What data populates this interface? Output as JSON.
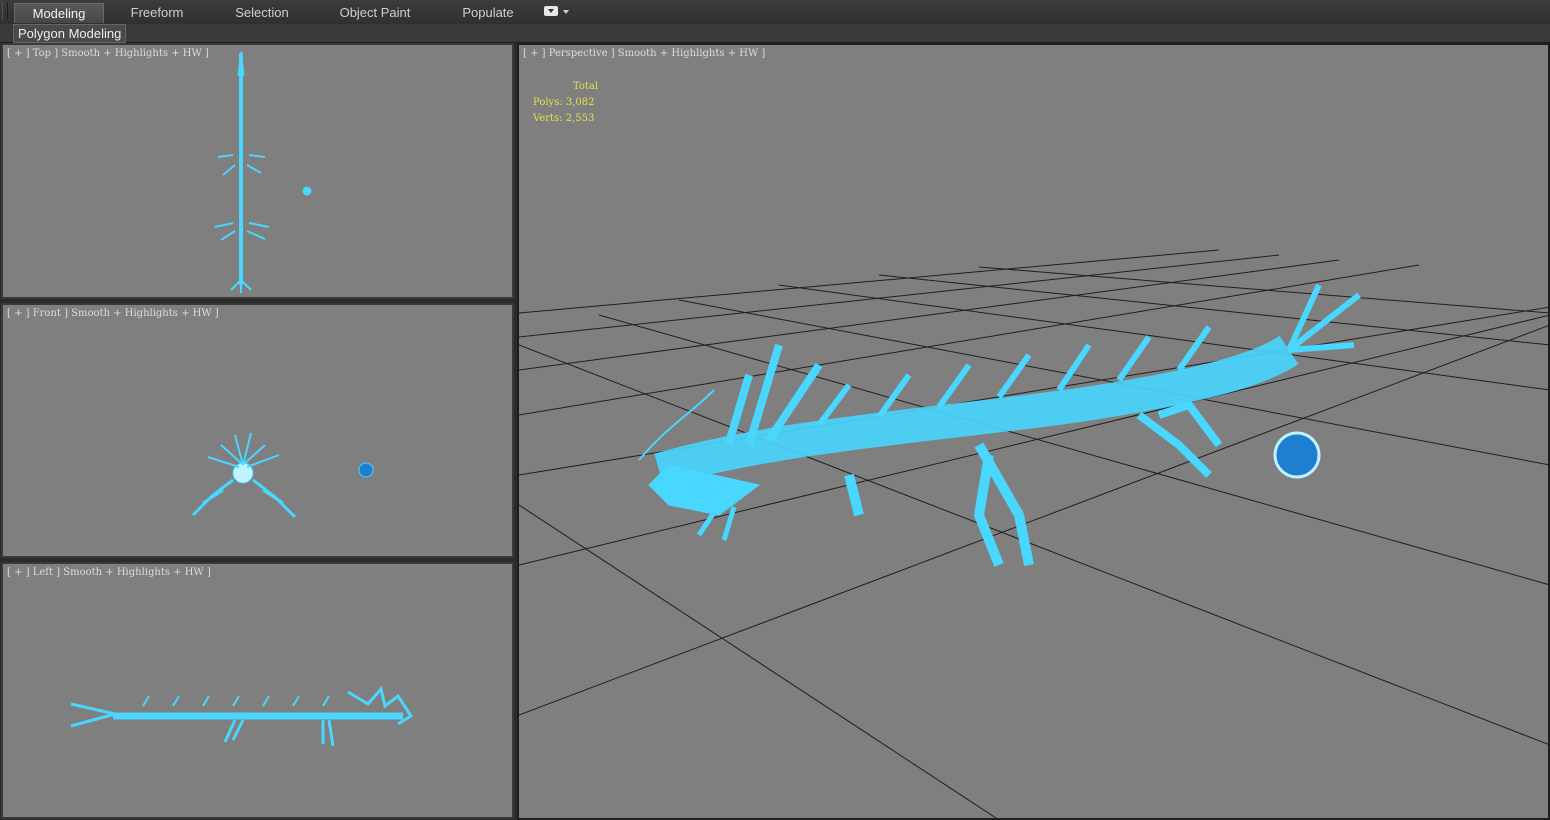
{
  "ribbon": {
    "tabs": [
      {
        "label": "Modeling"
      },
      {
        "label": "Freeform"
      },
      {
        "label": "Selection"
      },
      {
        "label": "Object Paint"
      },
      {
        "label": "Populate"
      }
    ],
    "subtab": "Polygon Modeling"
  },
  "viewports": {
    "top": {
      "label": "[ + ] Top ] Smooth + Highlights + HW ]"
    },
    "front": {
      "label": "[ + ] Front ] Smooth + Highlights + HW ]"
    },
    "left": {
      "label": "[ + ] Left ] Smooth + Highlights + HW ]"
    },
    "perspective": {
      "label": "[ + ] Perspective ] Smooth + Highlights + HW ]",
      "stats": {
        "total": "Total",
        "polys": "Polys: 3,082",
        "verts": "Verts: 2,553"
      }
    }
  },
  "colors": {
    "viewport_bg": "#7f7f7f",
    "model": "#49d6ff",
    "stats_text": "#e6e050"
  }
}
